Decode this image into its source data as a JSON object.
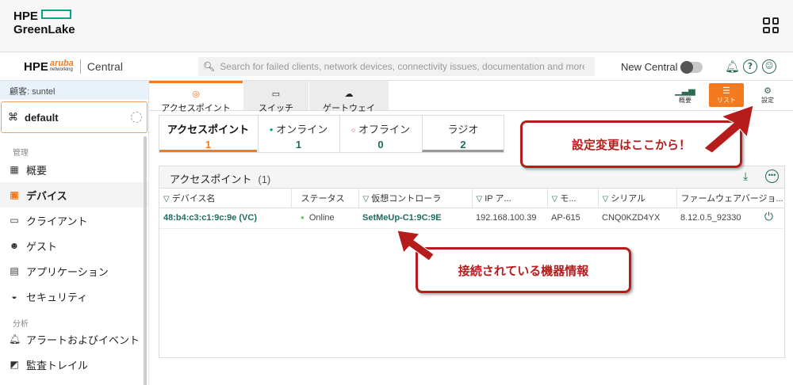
{
  "greenlake": {
    "logo_line1": "HPE",
    "logo_line2": "GreenLake"
  },
  "header": {
    "brand_hpe": "HPE",
    "brand_aruba": "aruba",
    "brand_networking": "networking",
    "brand_central": "Central",
    "search_placeholder": "Search for failed clients, network devices, connectivity issues, documentation and more",
    "new_central_label": "New Central"
  },
  "sidebar": {
    "customer": "顧客: suntel",
    "group": "default",
    "section_manage": "管理",
    "section_analyze": "分析",
    "items": [
      {
        "label": "概要",
        "icon": "grid-icon"
      },
      {
        "label": "デバイス",
        "icon": "device-icon",
        "active": true
      },
      {
        "label": "クライアント",
        "icon": "client-icon"
      },
      {
        "label": "ゲスト",
        "icon": "guest-icon"
      },
      {
        "label": "アプリケーション",
        "icon": "app-icon"
      },
      {
        "label": "セキュリティ",
        "icon": "shield-icon"
      },
      {
        "label": "アラートおよびイベント",
        "icon": "bell-icon"
      },
      {
        "label": "監査トレイル",
        "icon": "audit-icon"
      }
    ]
  },
  "device_tabs": [
    {
      "label": "アクセスポイント",
      "icon": "access-point-icon",
      "active": true
    },
    {
      "label": "スイッチ",
      "icon": "switch-icon"
    },
    {
      "label": "ゲートウェイ",
      "icon": "gateway-icon"
    }
  ],
  "view_buttons": [
    {
      "label": "概要",
      "icon": "bar-chart-icon"
    },
    {
      "label": "リスト",
      "icon": "list-icon",
      "active": true
    },
    {
      "label": "設定",
      "icon": "gear-icon"
    }
  ],
  "summary": [
    {
      "label": "アクセスポイント",
      "value": "1",
      "active": true
    },
    {
      "label": "オンライン",
      "value": "1",
      "status": "online"
    },
    {
      "label": "オフライン",
      "value": "0",
      "status": "offline"
    },
    {
      "label": "ラジオ",
      "value": "2"
    }
  ],
  "panel": {
    "title": "アクセスポイント",
    "count": "(1)",
    "columns": [
      "デバイス名",
      "ステータス",
      "仮想コントローラ",
      "IP ア...",
      "モ...",
      "シリアル",
      "ファームウェアバージョ..."
    ],
    "rows": [
      [
        "48:b4:c3:c1:9c:9e (VC)",
        "Online",
        "SetMeUp-C1:9C:9E",
        "192.168.100.39",
        "AP-615",
        "CNQ0KZD4YX",
        "8.12.0.5_92330"
      ]
    ]
  },
  "annotations": {
    "settings_note": "設定変更はここから！",
    "device_note": "接続されている機器情報"
  },
  "colors": {
    "accent": "#f47a20",
    "brand_green": "#01a982",
    "link": "#1d6b60",
    "annotation_red": "#b71c1c"
  }
}
